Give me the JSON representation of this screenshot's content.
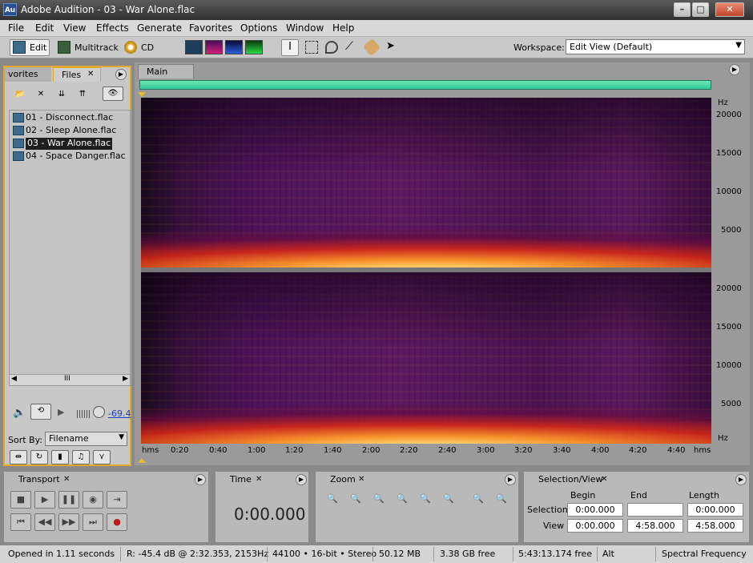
{
  "window": {
    "logo": "Au",
    "title": "Adobe Audition - 03 - War Alone.flac"
  },
  "menu": [
    "File",
    "Edit",
    "View",
    "Effects",
    "Generate",
    "Favorites",
    "Options",
    "Window",
    "Help"
  ],
  "toolbar": {
    "edit_label": "Edit",
    "multitrack_label": "Multitrack",
    "cd_label": "CD",
    "workspace_label": "Workspace:",
    "workspace_value": "Edit View (Default)"
  },
  "files_panel": {
    "tab_favorites": "vorites",
    "tab_files": "Files",
    "files": [
      {
        "name": "01 - Disconnect.flac",
        "selected": false
      },
      {
        "name": "02 - Sleep Alone.flac",
        "selected": false
      },
      {
        "name": "03 - War Alone.flac",
        "selected": true
      },
      {
        "name": "04 - Space Danger.flac",
        "selected": false
      }
    ],
    "scroll_grip": "III",
    "volume_value": "-69.4",
    "sort_by_label": "Sort By:",
    "sort_by_value": "Filename"
  },
  "main": {
    "tab": "Main",
    "freq_unit": "Hz",
    "freq_ticks": [
      "20000",
      "15000",
      "10000",
      "5000"
    ],
    "time_unit": "hms",
    "time_ticks": [
      "0:20",
      "0:40",
      "1:00",
      "1:20",
      "1:40",
      "2:00",
      "2:20",
      "2:40",
      "3:00",
      "3:20",
      "3:40",
      "4:00",
      "4:20",
      "4:40"
    ]
  },
  "transport": {
    "title": "Transport"
  },
  "time_panel": {
    "title": "Time",
    "value": "0:00.000"
  },
  "zoom_panel": {
    "title": "Zoom"
  },
  "selection_panel": {
    "title": "Selection/View",
    "col_begin": "Begin",
    "col_end": "End",
    "col_length": "Length",
    "row_selection": "Selection",
    "row_view": "View",
    "selection": {
      "begin": "0:00.000",
      "end": "",
      "length": "0:00.000"
    },
    "view": {
      "begin": "0:00.000",
      "end": "4:58.000",
      "length": "4:58.000"
    }
  },
  "status": {
    "opened": "Opened in 1.11 seconds",
    "cursor": "R: -45.4 dB @  2:32.353, 2153Hz",
    "format": "44100 • 16-bit • Stereo",
    "size": "50.12 MB",
    "disk_free": "3.38 GB free",
    "time_free": "5:43:13.174 free",
    "modifier": "Alt",
    "view_mode": "Spectral Frequency"
  },
  "colors": {
    "panel_focus": "#e0a92a",
    "overview": "#2ec79a",
    "spectral_hot": "#ffd24a",
    "spectral_cold": "#3a1140"
  }
}
